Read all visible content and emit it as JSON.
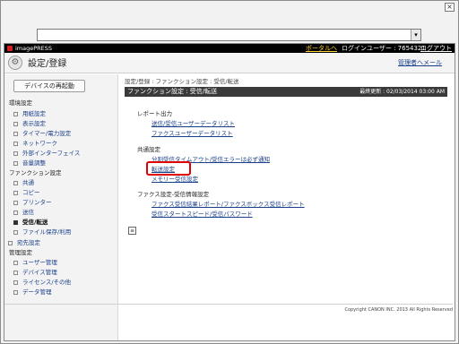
{
  "window": {
    "close_symbol": "×"
  },
  "address_bar": {
    "value": "",
    "arrow_symbol": "▾"
  },
  "topbar": {
    "brand": "imagePRESS",
    "portal_link": "ポータルへ",
    "login_user": "ログインユーザー : 7654321",
    "logout_link": "ログアウト"
  },
  "header": {
    "title": "設定/登録",
    "admin_link": "管理者へメール"
  },
  "sidebar": {
    "restart_button": "デバイスの再起動",
    "sections": [
      {
        "label": "環境設定",
        "items": [
          "用紙設定",
          "表示設定",
          "タイマー/電力設定",
          "ネットワーク",
          "外部インターフェイス",
          "音量調整"
        ]
      },
      {
        "label": "ファンクション設定",
        "items": [
          "共通",
          "コピー",
          "プリンター",
          "送信",
          "受信/転送",
          "ファイル保存/利用"
        ],
        "selected_index": 4
      },
      {
        "label": "",
        "items": [
          "宛先設定"
        ]
      },
      {
        "label": "管理設定",
        "items": [
          "ユーザー管理",
          "デバイス管理",
          "ライセンス/その他",
          "データ管理"
        ]
      }
    ]
  },
  "main": {
    "breadcrumb": "設定/登録 : ファンクション設定 : 受信/転送",
    "page_title": "ファンクション設定 : 受信/転送",
    "last_updated": "最終更新 : 02/03/2014 03:00 AM",
    "groups": [
      {
        "title": "レポート出力",
        "links": [
          "送信/受信ユーザーデータリスト",
          "ファクスユーザーデータリスト"
        ]
      },
      {
        "title": "共通設定",
        "links": [
          "分割受信タイムアウト/受信エラーは必ず通知",
          "転送設定",
          "メモリー受信設定"
        ]
      },
      {
        "title": "ファクス設定-受信情報設定",
        "links": [
          "ファクス受信結果レポート/ファクスボックス受信レポート",
          "受信スタートスピード/受信パスワード"
        ]
      }
    ],
    "mini_icon_symbol": "≡"
  },
  "footer": {
    "copyright": "Copyright CANON INC. 2013 All Rights Reserved"
  },
  "colors": {
    "highlight": "#e00000",
    "link": "#1a3f8a",
    "topbar_bg": "#000000",
    "portal_link": "#ffcf33"
  }
}
